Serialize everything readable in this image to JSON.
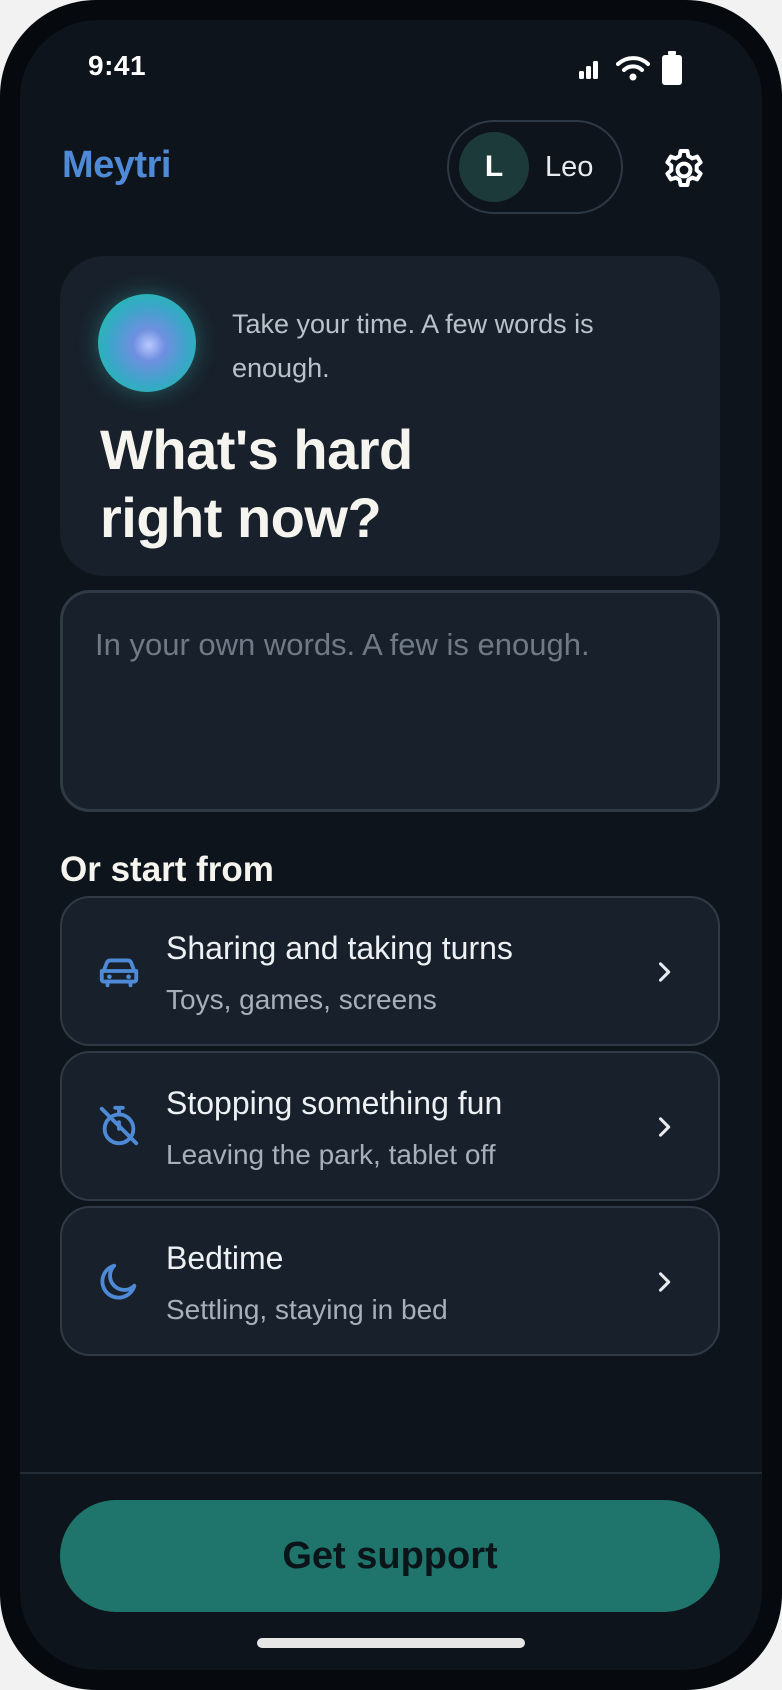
{
  "status_bar": {
    "time": "9:41"
  },
  "header": {
    "brand": "Meytri",
    "profile": {
      "initial": "L",
      "name": "Leo"
    }
  },
  "prompt_card": {
    "hint": "Take your time. A few words is enough.",
    "title_line1": "What's hard",
    "title_line2": "right now?"
  },
  "input": {
    "placeholder": "In your own words. A few is enough.",
    "value": ""
  },
  "starters": {
    "heading": "Or start from",
    "items": [
      {
        "title": "Sharing and taking turns",
        "subtitle": "Toys, games, screens",
        "icon": "car-icon"
      },
      {
        "title": "Stopping something fun",
        "subtitle": "Leaving the park, tablet off",
        "icon": "timer-off-icon"
      },
      {
        "title": "Bedtime",
        "subtitle": "Settling, staying in bed",
        "icon": "moon-icon"
      }
    ]
  },
  "cta": {
    "label": "Get support"
  },
  "colors": {
    "brand": "#4f8ad6",
    "accent": "#1f756b",
    "background": "#0e141b",
    "card": "#18212b"
  }
}
